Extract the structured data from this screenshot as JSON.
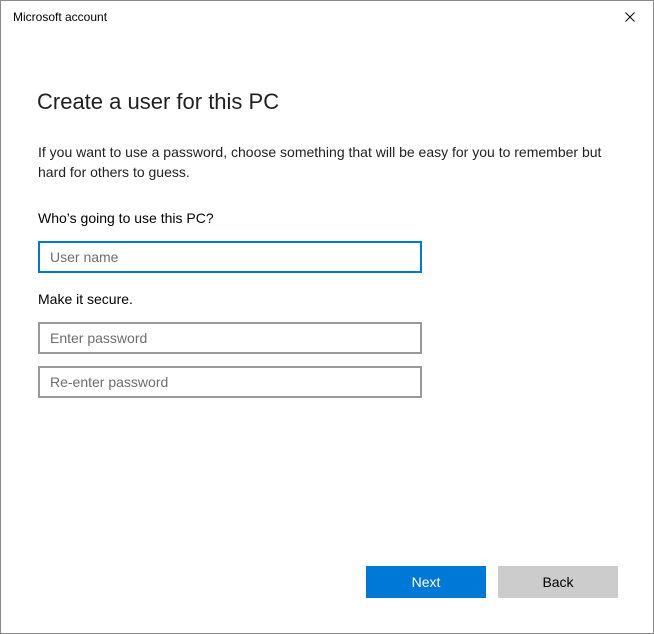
{
  "window": {
    "title": "Microsoft account",
    "close_icon": "close-icon"
  },
  "page": {
    "heading": "Create a user for this PC",
    "description": "If you want to use a password, choose something that will be easy for you to remember but hard for others to guess."
  },
  "who_section": {
    "label": "Who’s going to use this PC?",
    "username": {
      "value": "",
      "placeholder": "User name"
    }
  },
  "secure_section": {
    "label": "Make it secure.",
    "password": {
      "value": "",
      "placeholder": "Enter password"
    },
    "reenter_password": {
      "value": "",
      "placeholder": "Re-enter password"
    }
  },
  "buttons": {
    "next_label": "Next",
    "back_label": "Back"
  },
  "colors": {
    "accent": "#0078d7",
    "secondary_button": "#cccccc",
    "input_border": "#999999"
  }
}
